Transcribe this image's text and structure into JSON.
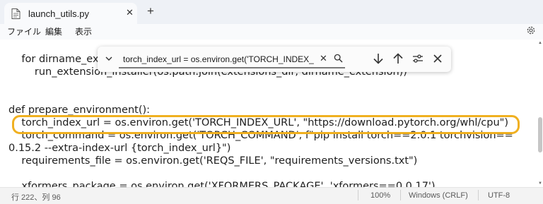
{
  "tab": {
    "title": "launch_utils.py",
    "close_glyph": "✕",
    "new_glyph": "+"
  },
  "menu": {
    "file": "ファイル",
    "edit": "編集",
    "view": "表示"
  },
  "editor": {
    "lines": [
      "    for dirname_ex",
      "        run_extension_installer(os.path.join(extensions_dir, dirname_extension))",
      "",
      "",
      "def prepare_environment():",
      "    torch_index_url = os.environ.get('TORCH_INDEX_URL', \"https://download.pytorch.org/whl/cpu\")",
      "    torch_command = os.environ.get('TORCH_COMMAND', f\"pip install torch==2.0.1 torchvision==",
      "0.15.2 --extra-index-url {torch_index_url}\")",
      "    requirements_file = os.environ.get('REQS_FILE', \"requirements_versions.txt\")",
      "",
      "    xformers_package = os.environ.get('XFORMERS_PACKAGE', 'xformers==0.0.17')"
    ]
  },
  "find": {
    "query": "torch_index_url = os.environ.get('TORCH_INDEX_URL', \"h",
    "clear_glyph": "✕"
  },
  "status": {
    "position": "行 222、列 96",
    "zoom": "100%",
    "line_ending": "Windows (CRLF)",
    "encoding": "UTF-8"
  },
  "colors": {
    "highlight": "#f0b020"
  }
}
